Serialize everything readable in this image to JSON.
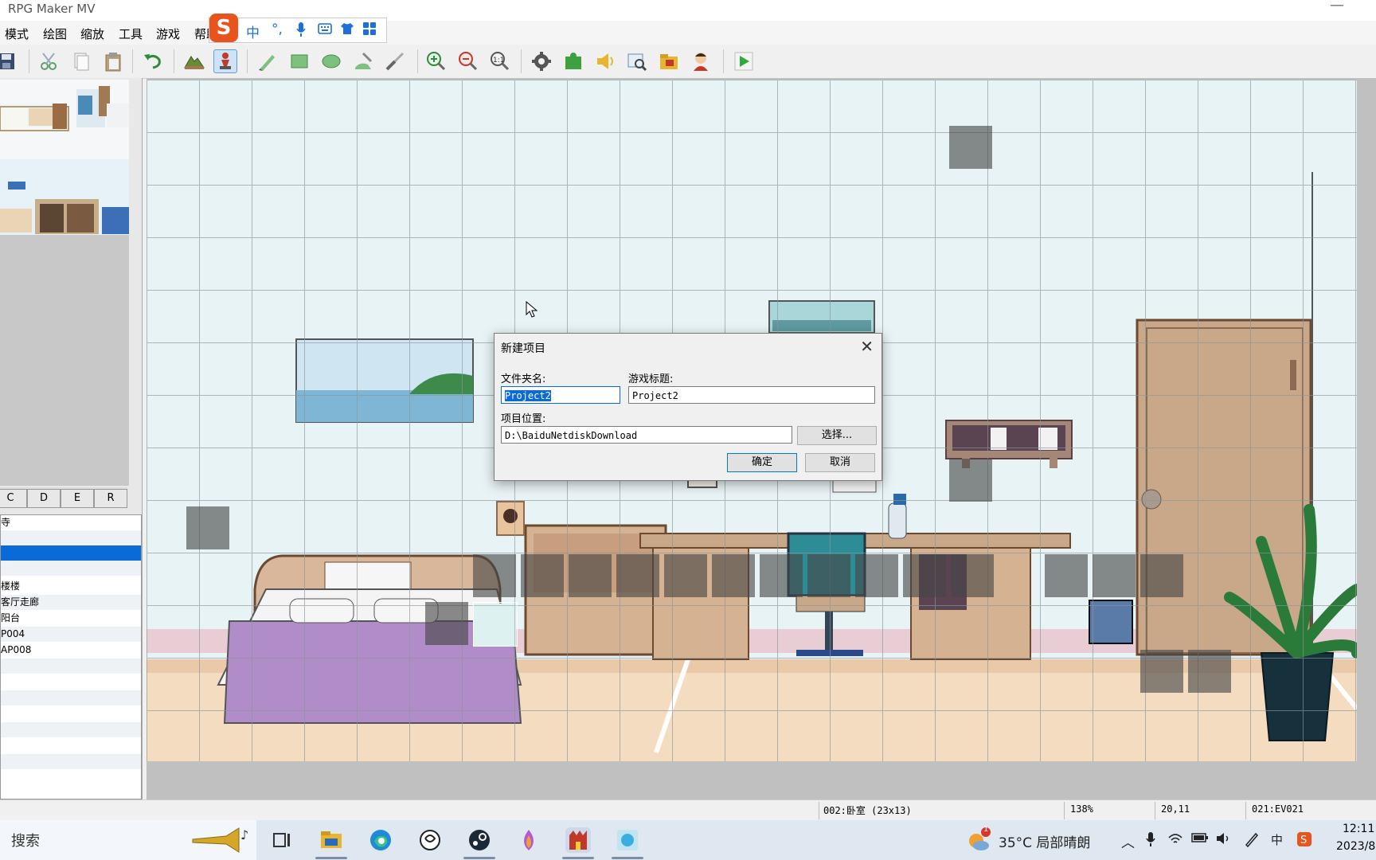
{
  "window": {
    "title": "RPG Maker MV"
  },
  "menu": [
    "模式",
    "绘图",
    "缩放",
    "工具",
    "游戏",
    "帮助"
  ],
  "ime": {
    "logo": "S",
    "mode": "中",
    "punct": "°,"
  },
  "toolbar": {
    "active_tool": "event-mode"
  },
  "tabs": [
    "C",
    "D",
    "E",
    "R"
  ],
  "maplist": [
    "寺",
    "",
    "",
    "",
    "楼楼",
    "客厅走廊",
    "阳台",
    "P004",
    "AP008"
  ],
  "dialog": {
    "title": "新建项目",
    "folder_label": "文件夹名:",
    "folder_value": "Project2",
    "game_title_label": "游戏标题:",
    "game_title_value": "Project2",
    "location_label": "项目位置:",
    "location_value": "D:\\BaiduNetdiskDownload",
    "choose_label": "选择...",
    "ok_label": "确定",
    "cancel_label": "取消"
  },
  "status": {
    "map": "002:卧室 (23x13)",
    "zoom": "138%",
    "coords": "20,11",
    "event": "021:EV021"
  },
  "taskbar": {
    "search_placeholder": "搜索",
    "weather": "35°C  局部晴朗",
    "weather_badge": "1",
    "time": "12:11",
    "date": "2023/8"
  }
}
